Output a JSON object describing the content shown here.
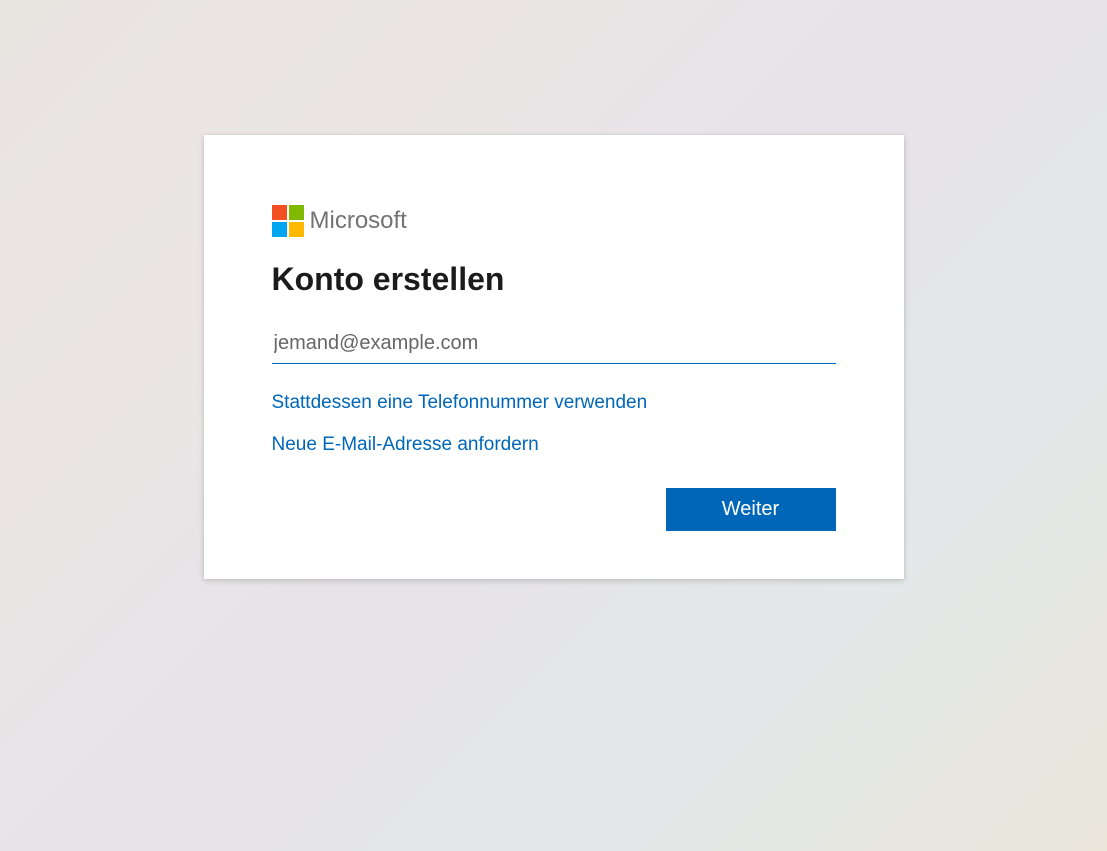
{
  "brand": {
    "name": "Microsoft",
    "colors": {
      "red": "#f25022",
      "green": "#7fba00",
      "blue": "#00a4ef",
      "yellow": "#ffb900"
    }
  },
  "card": {
    "heading": "Konto erstellen",
    "email_placeholder": "jemand@example.com",
    "email_value": "",
    "links": {
      "use_phone": "Stattdessen eine Telefonnummer verwenden",
      "new_email": "Neue E-Mail-Adresse anfordern"
    },
    "next_button": "Weiter"
  },
  "accent_color": "#0067b8"
}
